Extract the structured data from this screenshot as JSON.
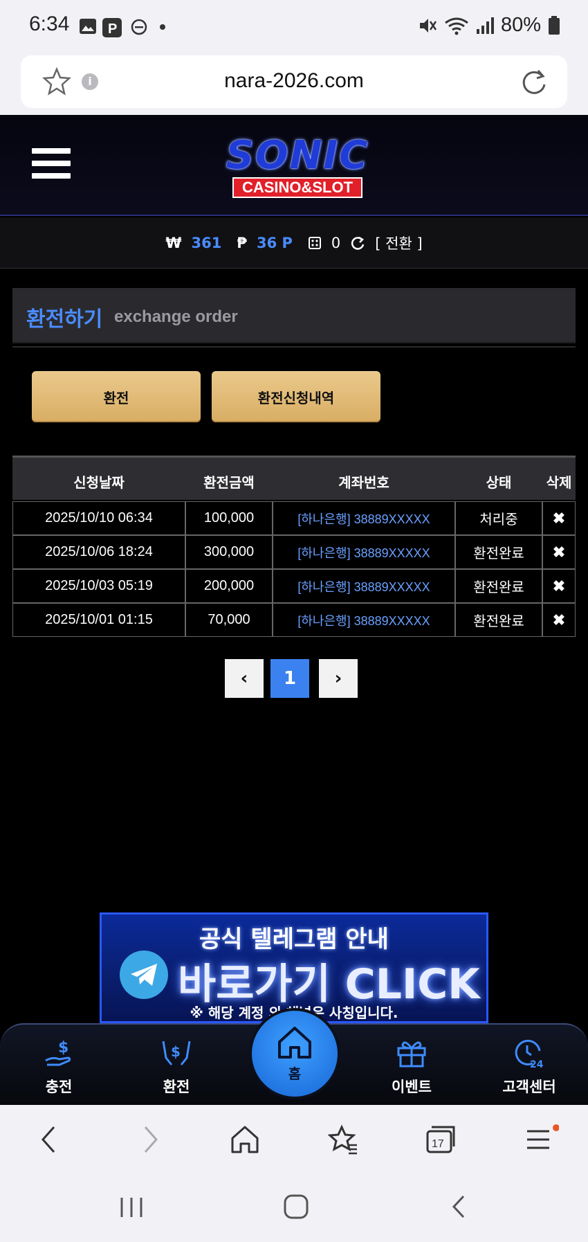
{
  "status_bar": {
    "time": "6:34",
    "battery": "80%"
  },
  "browser": {
    "url": "nara-2026.com",
    "tab_count": "17"
  },
  "site": {
    "logo_main": "SONIC",
    "logo_sub": "CASINO&SLOT"
  },
  "balance": {
    "won_symbol": "₩",
    "won_value": "361",
    "point_symbol": "₱",
    "point_value": "36 P",
    "chip_value": "0",
    "convert_label": "[ 전환 ]"
  },
  "section": {
    "title_ko": "환전하기",
    "title_en": "exchange order"
  },
  "tabs": {
    "exchange": "환전",
    "history": "환전신청내역"
  },
  "table": {
    "headers": [
      "신청날짜",
      "환전금액",
      "계좌번호",
      "상태",
      "삭제"
    ],
    "rows": [
      {
        "date": "2025/10/10 06:34",
        "amount": "100,000",
        "account": "[하나은행] 38889XXXXX",
        "status": "처리중",
        "delete": "✖"
      },
      {
        "date": "2025/10/06 18:24",
        "amount": "300,000",
        "account": "[하나은행] 38889XXXXX",
        "status": "환전완료",
        "delete": "✖"
      },
      {
        "date": "2025/10/03 05:19",
        "amount": "200,000",
        "account": "[하나은행] 38889XXXXX",
        "status": "환전완료",
        "delete": "✖"
      },
      {
        "date": "2025/10/01 01:15",
        "amount": "70,000",
        "account": "[하나은행] 38889XXXXX",
        "status": "환전완료",
        "delete": "✖"
      }
    ]
  },
  "pagination": {
    "prev": "‹",
    "current": "1",
    "next": "›"
  },
  "banner": {
    "title": "공식 텔레그램 안내",
    "click_text": "바로가기 CLICK",
    "note": "※ 해당 계정 외 채널은 사칭입니다."
  },
  "bottom_nav": {
    "deposit": "충전",
    "withdraw": "환전",
    "home": "홈",
    "event": "이벤트",
    "support": "고객센터"
  },
  "colors": {
    "accent_blue": "#4a8cff",
    "button_gold": "#e0b872",
    "page_active": "#3b82f0"
  }
}
